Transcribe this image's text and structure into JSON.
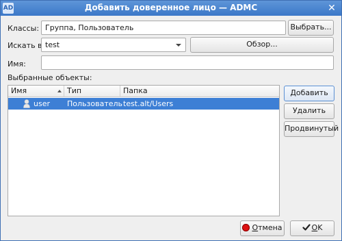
{
  "window": {
    "title": "Добавить доверенное лицо — ADMC",
    "logo": "AD"
  },
  "form": {
    "classes_label": "Классы:",
    "classes_value": "Группа, Пользователь",
    "select_button": "Выбрать...",
    "search_in_label": "Искать в:",
    "search_in_value": "test",
    "browse_button": "Обзор...",
    "name_label": "Имя:",
    "name_value": "",
    "selected_label": "Выбранные объекты:"
  },
  "table": {
    "columns": [
      "Имя",
      "Тип",
      "Папка"
    ],
    "sort_column": "Имя",
    "rows": [
      {
        "name": "user",
        "type": "Пользователь",
        "folder": "test.alt/Users",
        "icon": "user-icon",
        "selected": true
      }
    ]
  },
  "side_buttons": {
    "add": "Добавить",
    "remove": "Удалить",
    "advanced": "Продвинутый"
  },
  "footer": {
    "cancel_first": "О",
    "cancel_rest": "тмена",
    "ok_first": "O",
    "ok_rest": "K"
  },
  "colors": {
    "title_bar": "#3b78c8",
    "selection": "#3d7fd5",
    "cancel_icon": "#dd1111"
  }
}
